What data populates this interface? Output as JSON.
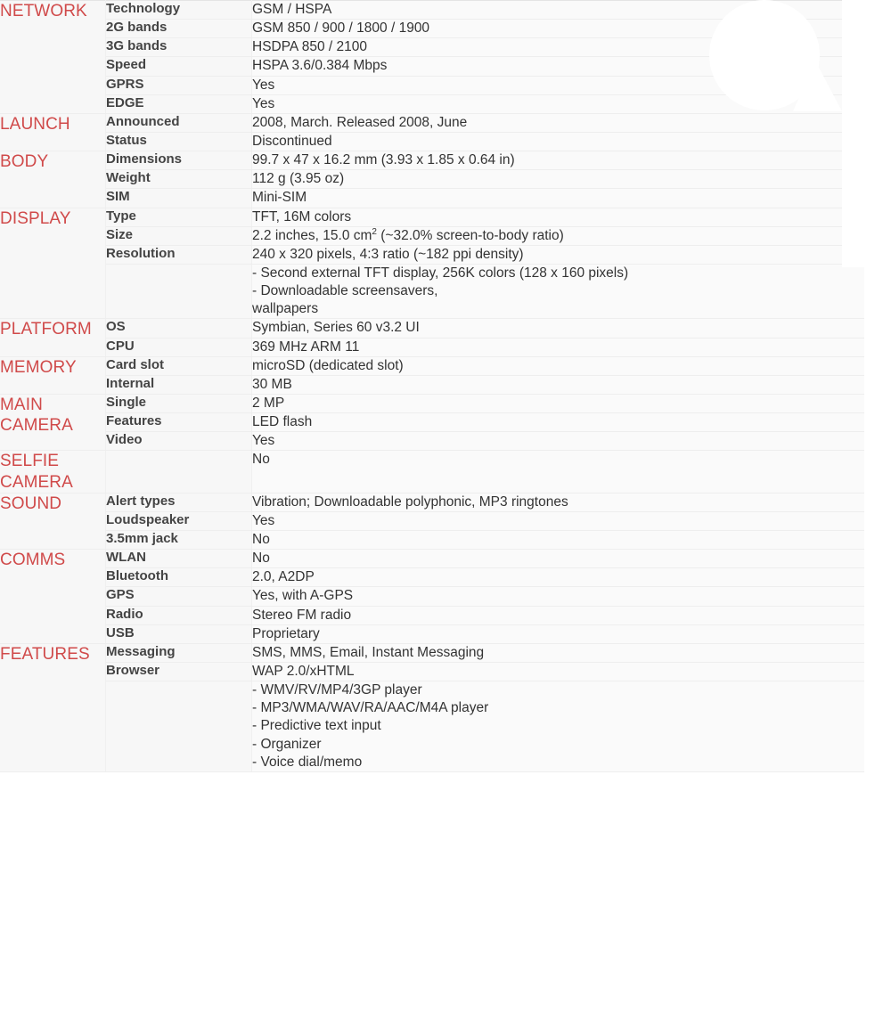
{
  "page": {
    "title": "Phone specifications sheet",
    "accent_color": "#d04a4a",
    "label_color": "#444444",
    "value_color": "#333333",
    "row_bg": "#fafafa",
    "row_alt_bg": "#f6f6f6"
  },
  "sections": [
    {
      "name": "NETWORK",
      "rows": [
        {
          "label": "Technology",
          "value": "GSM / HSPA"
        },
        {
          "label": "2G bands",
          "value": "GSM 850 / 900 / 1800 / 1900"
        },
        {
          "label": "3G bands",
          "value": "HSDPA 850 / 2100"
        },
        {
          "label": "Speed",
          "value": "HSPA 3.6/0.384 Mbps"
        },
        {
          "label": "GPRS",
          "value": "Yes"
        },
        {
          "label": "EDGE",
          "value": "Yes"
        }
      ]
    },
    {
      "name": "LAUNCH",
      "rows": [
        {
          "label": "Announced",
          "value": "2008, March. Released 2008, June"
        },
        {
          "label": "Status",
          "value": "Discontinued"
        }
      ]
    },
    {
      "name": "BODY",
      "rows": [
        {
          "label": "Dimensions",
          "value": "99.7 x 47 x 16.2 mm (3.93 x 1.85 x 0.64 in)"
        },
        {
          "label": "Weight",
          "value": "112 g (3.95 oz)"
        },
        {
          "label": "SIM",
          "value": "Mini-SIM"
        }
      ]
    },
    {
      "name": "DISPLAY",
      "rows": [
        {
          "label": "Type",
          "value": "TFT, 16M colors"
        },
        {
          "label": "Size",
          "value_pre": "2.2 inches, 15.0 cm",
          "value_sup": "2",
          "value_post": " (~32.0% screen-to-body ratio)"
        },
        {
          "label": "Resolution",
          "value": "240 x 320 pixels, 4:3 ratio (~182 ppi density)"
        },
        {
          "label": "",
          "value": "- Second external TFT display, 256K colors (128 x 160 pixels)\n- Downloadable screensavers,\nwallpapers"
        }
      ]
    },
    {
      "name": "PLATFORM",
      "rows": [
        {
          "label": "OS",
          "value": "Symbian, Series 60 v3.2 UI"
        },
        {
          "label": "CPU",
          "value": "369 MHz ARM 11"
        }
      ]
    },
    {
      "name": "MEMORY",
      "rows": [
        {
          "label": "Card slot",
          "value": "microSD (dedicated slot)"
        },
        {
          "label": "Internal",
          "value": "30 MB"
        }
      ]
    },
    {
      "name": "MAIN\nCAMERA",
      "rows": [
        {
          "label": "Single",
          "value": "2 MP"
        },
        {
          "label": "Features",
          "value": "LED flash"
        },
        {
          "label": "Video",
          "value": "Yes"
        }
      ]
    },
    {
      "name": "SELFIE\nCAMERA",
      "rows": [
        {
          "label": "",
          "value": "No"
        }
      ]
    },
    {
      "name": "SOUND",
      "rows": [
        {
          "label": "Alert types",
          "value": "Vibration; Downloadable polyphonic, MP3 ringtones"
        },
        {
          "label": "Loudspeaker",
          "value": "Yes"
        },
        {
          "label": "3.5mm jack",
          "value": "No"
        }
      ]
    },
    {
      "name": "COMMS",
      "rows": [
        {
          "label": "WLAN",
          "value": "No"
        },
        {
          "label": "Bluetooth",
          "value": "2.0, A2DP"
        },
        {
          "label": "GPS",
          "value": "Yes, with A-GPS"
        },
        {
          "label": "Radio",
          "value": "Stereo FM radio"
        },
        {
          "label": "USB",
          "value": "Proprietary"
        }
      ]
    },
    {
      "name": "FEATURES",
      "rows": [
        {
          "label": "Messaging",
          "value": "SMS, MMS, Email, Instant Messaging"
        },
        {
          "label": "Browser",
          "value": "WAP 2.0/xHTML"
        },
        {
          "label": "",
          "value": "- WMV/RV/MP4/3GP player\n- MP3/WMA/WAV/RA/AAC/M4A player\n- Predictive text input\n- Organizer\n- Voice dial/memo"
        }
      ]
    }
  ]
}
